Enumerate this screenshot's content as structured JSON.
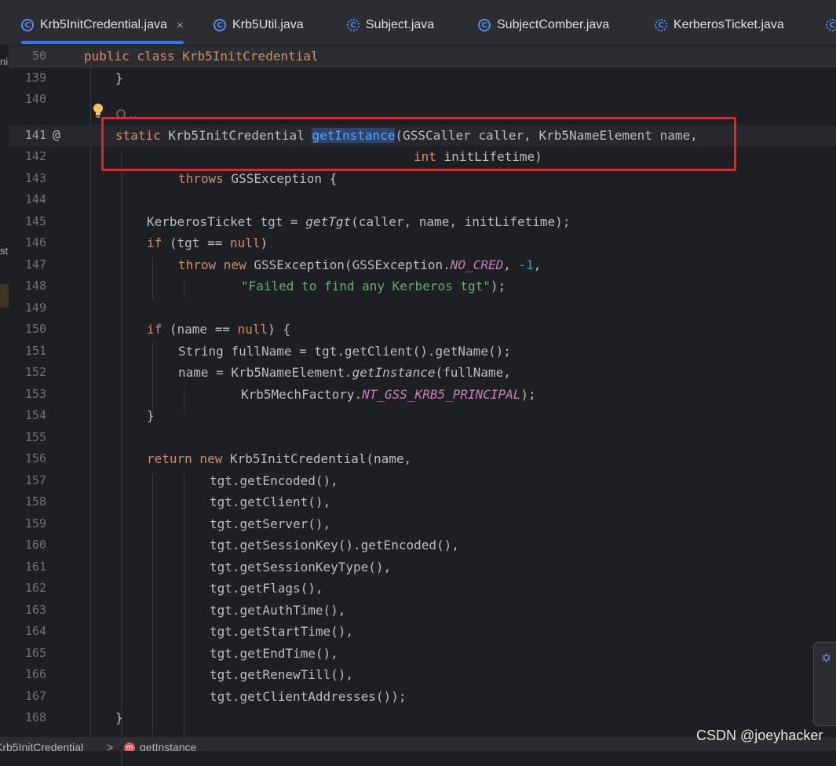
{
  "tabs": [
    {
      "label": "Krb5InitCredential.java",
      "icon": "class-icon",
      "active": true,
      "closable": true
    },
    {
      "label": "Krb5Util.java",
      "icon": "class-icon"
    },
    {
      "label": "Subject.java",
      "icon": "library-class-icon"
    },
    {
      "label": "SubjectComber.java",
      "icon": "class-icon"
    },
    {
      "label": "KerberosTicket.java",
      "icon": "library-class-icon"
    }
  ],
  "close_glyph": "×",
  "sticky_header": {
    "line": "50",
    "code": "public class Krb5InitCredential"
  },
  "lines": [
    {
      "n": "139"
    },
    {
      "n": "140"
    },
    {
      "n": "141"
    },
    {
      "n": "142"
    },
    {
      "n": "143"
    },
    {
      "n": "144"
    },
    {
      "n": "145"
    },
    {
      "n": "146"
    },
    {
      "n": "147"
    },
    {
      "n": "148"
    },
    {
      "n": "149"
    },
    {
      "n": "150"
    },
    {
      "n": "151"
    },
    {
      "n": "152"
    },
    {
      "n": "153"
    },
    {
      "n": "154"
    },
    {
      "n": "155"
    },
    {
      "n": "156"
    },
    {
      "n": "157"
    },
    {
      "n": "158"
    },
    {
      "n": "159"
    },
    {
      "n": "160"
    },
    {
      "n": "161"
    },
    {
      "n": "162"
    },
    {
      "n": "163"
    },
    {
      "n": "164"
    },
    {
      "n": "165"
    },
    {
      "n": "166"
    },
    {
      "n": "167"
    },
    {
      "n": "168"
    }
  ],
  "code": {
    "l139": "}",
    "l141a": "static",
    "l141b": " Krb5InitCredential ",
    "l141c": "getInstance",
    "l141d": "(GSSCaller caller, Krb5NameElement name,",
    "l142a": "int",
    "l142b": " initLifetime)",
    "l143a": "throws",
    "l143b": " GSSException {",
    "l145a": "KerberosTicket tgt = ",
    "l145b": "getTgt",
    "l145c": "(caller, name, initLifetime);",
    "l146a": "if",
    "l146b": " (tgt == ",
    "l146c": "null",
    "l146d": ")",
    "l147a": "throw new",
    "l147b": " GSSException(GSSException.",
    "l147c": "NO_CRED",
    "l147d": ", ",
    "l147e": "-1",
    "l147f": ",",
    "l148a": "\"Failed to find any Kerberos tgt\"",
    "l148b": ");",
    "l150a": "if",
    "l150b": " (name == ",
    "l150c": "null",
    "l150d": ") {",
    "l151": "String fullName = tgt.getClient().getName();",
    "l152a": "name = Krb5NameElement.",
    "l152b": "getInstance",
    "l152c": "(fullName,",
    "l153a": "Krb5MechFactory.",
    "l153b": "NT_GSS_KRB5_PRINCIPAL",
    "l153c": ");",
    "l154": "}",
    "l156a": "return new",
    "l156b": " Krb5InitCredential(name,",
    "l157": "tgt.getEncoded(),",
    "l158": "tgt.getClient(),",
    "l159": "tgt.getServer(),",
    "l160": "tgt.getSessionKey().getEncoded(),",
    "l161": "tgt.getSessionKeyType(),",
    "l162": "tgt.getFlags(),",
    "l163": "tgt.getAuthTime(),",
    "l164": "tgt.getStartTime(),",
    "l165": "tgt.getEndTime(),",
    "l166": "tgt.getRenewTill(),",
    "l167": "tgt.getClientAddresses());",
    "l168": "}"
  },
  "gutter": {
    "override_marker": "@"
  },
  "left_fragments": {
    "a": "ni",
    "b": "st"
  },
  "breadcrumb": {
    "class": "Krb5InitCredential",
    "sep": ">",
    "method": "getInstance",
    "method_icon": "m"
  },
  "watermark": "CSDN @joeyhacker",
  "colors": {
    "highlight_box": "#e8222a",
    "accent": "#3574f0",
    "background": "#1e1f22"
  }
}
